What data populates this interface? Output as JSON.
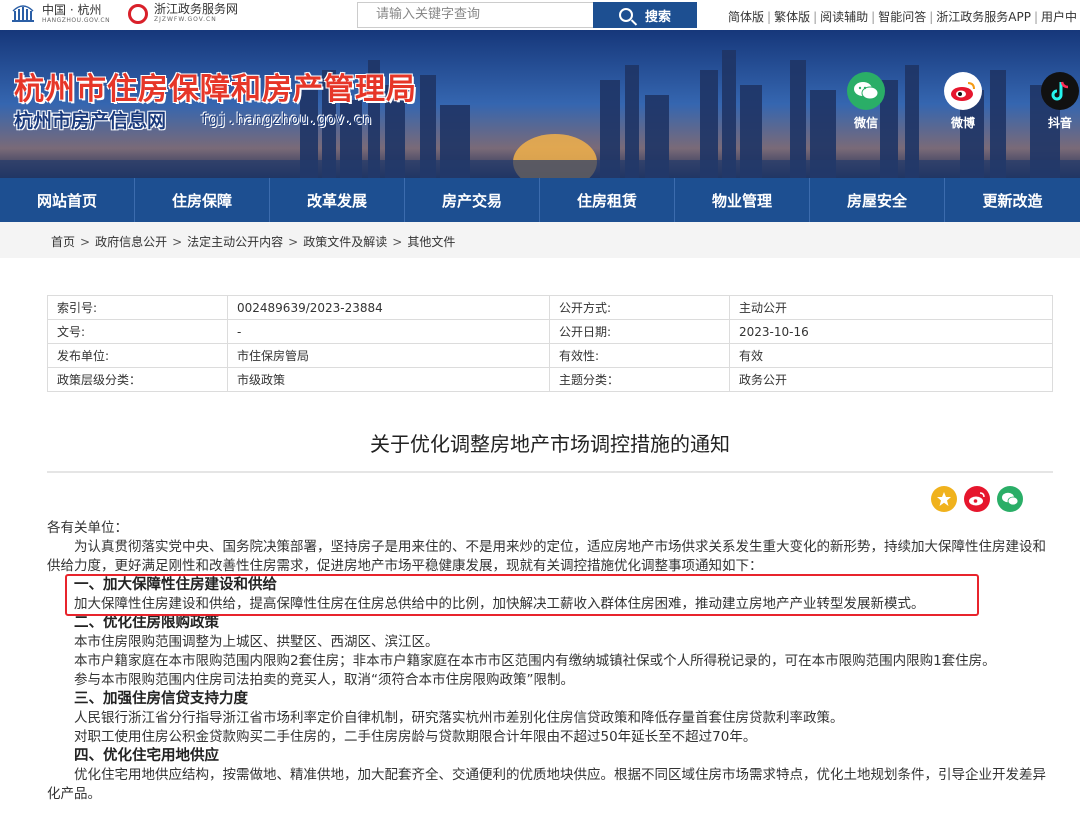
{
  "topbar": {
    "logo1": {
      "title": "中国 · 杭州",
      "domain": "HANGZHOU.GOV.CN"
    },
    "logo2": {
      "title": "浙江政务服务网",
      "domain": "ZJZWFW.GOV.CN"
    },
    "search": {
      "placeholder": "请输入关键字查询",
      "button": "搜索"
    },
    "links": [
      "简体版",
      "繁体版",
      "阅读辅助",
      "智能问答",
      "浙江政务服务APP",
      "用户中"
    ]
  },
  "banner": {
    "title": "杭州市住房保障和房产管理局",
    "subtitle": "杭州市房产信息网",
    "url": "fgj.hangzhou.gov.cn",
    "social": [
      {
        "label": "微信",
        "icon": "wechat-icon",
        "color": "#2aae67"
      },
      {
        "label": "微博",
        "icon": "weibo-icon",
        "color": "#e6162d"
      },
      {
        "label": "抖音",
        "icon": "douyin-icon",
        "color": "#111111"
      }
    ]
  },
  "nav": [
    "网站首页",
    "住房保障",
    "改革发展",
    "房产交易",
    "住房租赁",
    "物业管理",
    "房屋安全",
    "更新改造"
  ],
  "breadcrumb": [
    "首页",
    "政府信息公开",
    "法定主动公开内容",
    "政策文件及解读",
    "其他文件"
  ],
  "info": [
    {
      "k1": "索引号:",
      "v1": "002489639/2023-23884",
      "k2": "公开方式:",
      "v2": "主动公开"
    },
    {
      "k1": "文号:",
      "v1": "-",
      "k2": "公开日期:",
      "v2": "2023-10-16"
    },
    {
      "k1": "发布单位:",
      "v1": "市住保房管局",
      "k2": "有效性:",
      "v2": "有效"
    },
    {
      "k1": "政策层级分类：",
      "v1": "市级政策",
      "k2": "主题分类：",
      "v2": "政务公开"
    }
  ],
  "doc": {
    "title": "关于优化调整房地产市场调控措施的通知",
    "share": [
      {
        "icon": "favorite-star-icon",
        "color": "#f0b21d"
      },
      {
        "icon": "weibo-share-icon",
        "color": "#e6162d"
      },
      {
        "icon": "wechat-share-icon",
        "color": "#2aae67"
      }
    ],
    "paragraphs": [
      {
        "type": "plain",
        "text": "各有关单位："
      },
      {
        "type": "ind",
        "text": "为认真贯彻落实党中央、国务院决策部署，坚持房子是用来住的、不是用来炒的定位，适应房地产市场供求关系发生重大变化的新形势，持续加大保障性住房建设和供给力度，更好满足刚性和改善性住房需求，促进房地产市场平稳健康发展，现就有关调控措施优化调整事项通知如下："
      },
      {
        "type": "hd",
        "text": "一、加大保障性住房建设和供给"
      },
      {
        "type": "ind",
        "text": "加大保障性住房建设和供给，提高保障性住房在住房总供给中的比例，加快解决工薪收入群体住房困难，推动建立房地产产业转型发展新模式。"
      },
      {
        "type": "hd",
        "text": "二、优化住房限购政策"
      },
      {
        "type": "ind",
        "text": "本市住房限购范围调整为上城区、拱墅区、西湖区、滨江区。"
      },
      {
        "type": "ind",
        "text": "本市户籍家庭在本市限购范围内限购2套住房；非本市户籍家庭在本市市区范围内有缴纳城镇社保或个人所得税记录的，可在本市限购范围内限购1套住房。"
      },
      {
        "type": "ind",
        "text": "参与本市限购范围内住房司法拍卖的竞买人，取消“须符合本市住房限购政策”限制。"
      },
      {
        "type": "hd",
        "text": "三、加强住房信贷支持力度"
      },
      {
        "type": "ind",
        "text": "人民银行浙江省分行指导浙江省市场利率定价自律机制，研究落实杭州市差别化住房信贷政策和降低存量首套住房贷款利率政策。"
      },
      {
        "type": "ind",
        "text": "对职工使用住房公积金贷款购买二手住房的，二手住房房龄与贷款期限合计年限由不超过50年延长至不超过70年。"
      },
      {
        "type": "hd",
        "text": "四、优化住宅用地供应"
      },
      {
        "type": "ind",
        "text": "优化住宅用地供应结构，按需做地、精准供地，加大配套齐全、交通便利的优质地块供应。根据不同区域住房市场需求特点，优化土地规划条件，引导企业开发差异化产品。"
      }
    ]
  }
}
